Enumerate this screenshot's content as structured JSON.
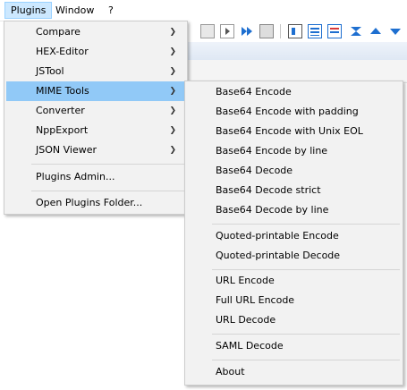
{
  "menubar": {
    "items": [
      {
        "label": "Plugins",
        "active": true
      },
      {
        "label": "Window",
        "active": false
      },
      {
        "label": "?",
        "active": false
      }
    ]
  },
  "plugins_menu": {
    "items": [
      {
        "label": "Compare",
        "submenu": true
      },
      {
        "label": "HEX-Editor",
        "submenu": true
      },
      {
        "label": "JSTool",
        "submenu": true
      },
      {
        "label": "MIME Tools",
        "submenu": true,
        "highlighted": true
      },
      {
        "label": "Converter",
        "submenu": true
      },
      {
        "label": "NppExport",
        "submenu": true
      },
      {
        "label": "JSON Viewer",
        "submenu": true
      },
      {
        "label": "Plugins Admin..."
      },
      {
        "label": "Open Plugins Folder..."
      }
    ],
    "arrow_glyph": "❯"
  },
  "mime_tools_menu": {
    "items": [
      {
        "label": "Base64 Encode"
      },
      {
        "label": "Base64 Encode with padding"
      },
      {
        "label": "Base64 Encode with Unix EOL"
      },
      {
        "label": "Base64 Encode by line"
      },
      {
        "label": "Base64 Decode"
      },
      {
        "label": "Base64 Decode strict"
      },
      {
        "label": "Base64 Decode by line"
      },
      {
        "label": "Quoted-printable Encode"
      },
      {
        "label": "Quoted-printable Decode"
      },
      {
        "label": "URL Encode"
      },
      {
        "label": "Full URL Encode"
      },
      {
        "label": "URL Decode"
      },
      {
        "label": "SAML Decode"
      },
      {
        "label": "About"
      }
    ]
  },
  "toolbar": {
    "icons": [
      "stop-record-icon",
      "play-macro-icon",
      "run-macro-multiple-icon",
      "save-macro-icon",
      "show-all-chars-icon",
      "function-list-icon",
      "document-map-icon",
      "folder-workspace-icon",
      "move-up-icon",
      "move-down-icon"
    ]
  },
  "colors": {
    "menu_bg": "#f2f2f2",
    "highlight": "#91c9f7",
    "menubar_active_bg": "#cce8ff",
    "menubar_active_border": "#99d1ff",
    "toolbar_blue": "#1e6fd0"
  }
}
